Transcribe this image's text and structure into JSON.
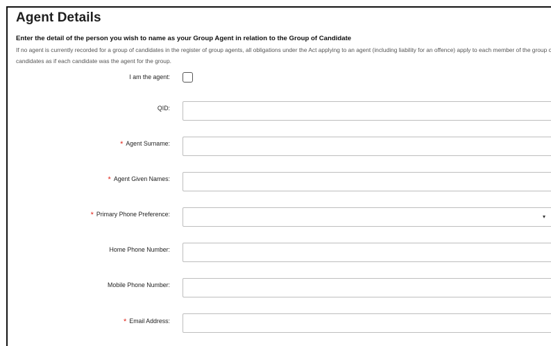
{
  "section": {
    "title": "Agent Details",
    "subtitle": "Enter the detail of the person you wish to name as your Group Agent in relation to the Group of Candidate",
    "note": "If no agent is currently recorded for a group of candidates in the register of group agents, all obligations under the Act applying to an agent (including liability for an offence) apply to each member of the group of candidates as if each candidate was the agent for the group."
  },
  "form": {
    "i_am_agent": {
      "label": "I am the agent:",
      "checked": false
    },
    "qid": {
      "label": "QID:",
      "value": "",
      "required": false
    },
    "surname": {
      "label": "Agent Surname:",
      "value": "",
      "required": true
    },
    "given_names": {
      "label": "Agent Given Names:",
      "value": "",
      "required": true
    },
    "phone_pref": {
      "label": "Primary Phone Preference:",
      "value": "",
      "required": true,
      "caret_icon": "▾"
    },
    "home_phone": {
      "label": "Home Phone Number:",
      "value": "",
      "required": false
    },
    "mobile_phone": {
      "label": "Mobile Phone Number:",
      "value": "",
      "required": false
    },
    "email": {
      "label": "Email Address:",
      "value": "",
      "required": true
    },
    "required_marker": "*"
  },
  "colors": {
    "required": "#e0251b",
    "border": "#bdbdbd",
    "heading": "#1e1e1e"
  }
}
